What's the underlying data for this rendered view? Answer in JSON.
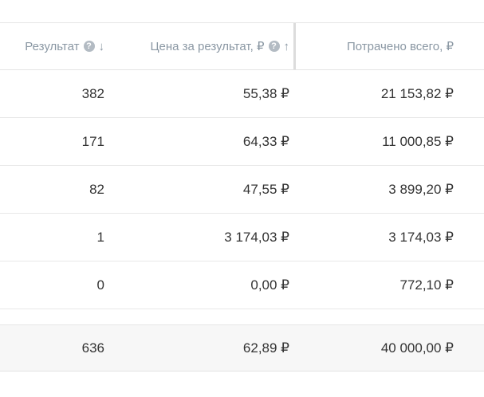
{
  "header": {
    "result": {
      "label": "Результат",
      "sort": "↓"
    },
    "price_per_result": {
      "label": "Цена за результат, ₽",
      "sort": "↑"
    },
    "spent_total": {
      "label": "Потрачено всего, ₽"
    },
    "help_icon_glyph": "?"
  },
  "rows": [
    {
      "result": "382",
      "price": "55,38 ₽",
      "spent": "21 153,82 ₽"
    },
    {
      "result": "171",
      "price": "64,33 ₽",
      "spent": "11 000,85 ₽"
    },
    {
      "result": "82",
      "price": "47,55 ₽",
      "spent": "3 899,20 ₽"
    },
    {
      "result": "1",
      "price": "3 174,03 ₽",
      "spent": "3 174,03 ₽"
    },
    {
      "result": "0",
      "price": "0,00 ₽",
      "spent": "772,10 ₽"
    }
  ],
  "total": {
    "result": "636",
    "price": "62,89 ₽",
    "spent": "40 000,00 ₽"
  },
  "colors": {
    "header_text": "#8a97a3",
    "body_text": "#333333",
    "total_background": "#f7f7f7",
    "row_border": "#e8e8e8"
  },
  "icons": [
    "help-icon",
    "sort-desc-icon",
    "sort-asc-icon"
  ]
}
